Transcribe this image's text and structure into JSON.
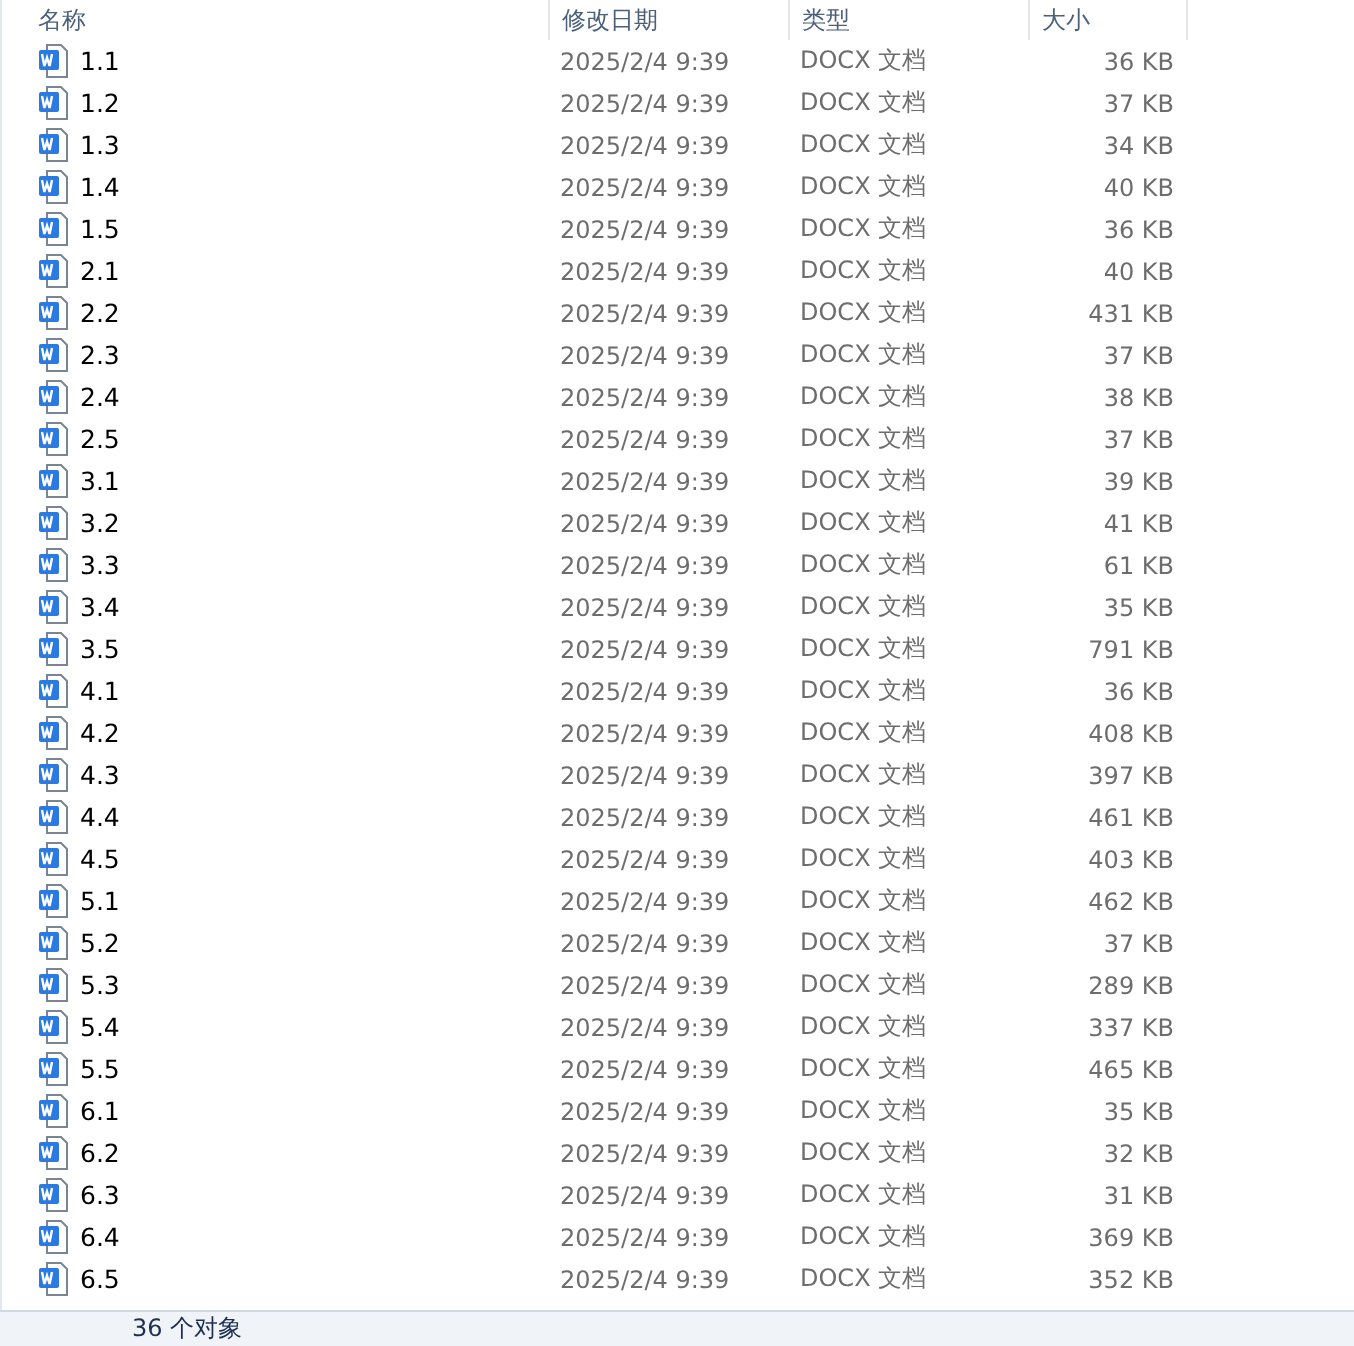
{
  "columns": [
    "名称",
    "修改日期",
    "类型",
    "大小"
  ],
  "rows": [
    {
      "name": "1.1",
      "modified": "2025/2/4 9:39",
      "type": "DOCX 文档",
      "size": "36 KB"
    },
    {
      "name": "1.2",
      "modified": "2025/2/4 9:39",
      "type": "DOCX 文档",
      "size": "37 KB"
    },
    {
      "name": "1.3",
      "modified": "2025/2/4 9:39",
      "type": "DOCX 文档",
      "size": "34 KB"
    },
    {
      "name": "1.4",
      "modified": "2025/2/4 9:39",
      "type": "DOCX 文档",
      "size": "40 KB"
    },
    {
      "name": "1.5",
      "modified": "2025/2/4 9:39",
      "type": "DOCX 文档",
      "size": "36 KB"
    },
    {
      "name": "2.1",
      "modified": "2025/2/4 9:39",
      "type": "DOCX 文档",
      "size": "40 KB"
    },
    {
      "name": "2.2",
      "modified": "2025/2/4 9:39",
      "type": "DOCX 文档",
      "size": "431 KB"
    },
    {
      "name": "2.3",
      "modified": "2025/2/4 9:39",
      "type": "DOCX 文档",
      "size": "37 KB"
    },
    {
      "name": "2.4",
      "modified": "2025/2/4 9:39",
      "type": "DOCX 文档",
      "size": "38 KB"
    },
    {
      "name": "2.5",
      "modified": "2025/2/4 9:39",
      "type": "DOCX 文档",
      "size": "37 KB"
    },
    {
      "name": "3.1",
      "modified": "2025/2/4 9:39",
      "type": "DOCX 文档",
      "size": "39 KB"
    },
    {
      "name": "3.2",
      "modified": "2025/2/4 9:39",
      "type": "DOCX 文档",
      "size": "41 KB"
    },
    {
      "name": "3.3",
      "modified": "2025/2/4 9:39",
      "type": "DOCX 文档",
      "size": "61 KB"
    },
    {
      "name": "3.4",
      "modified": "2025/2/4 9:39",
      "type": "DOCX 文档",
      "size": "35 KB"
    },
    {
      "name": "3.5",
      "modified": "2025/2/4 9:39",
      "type": "DOCX 文档",
      "size": "791 KB"
    },
    {
      "name": "4.1",
      "modified": "2025/2/4 9:39",
      "type": "DOCX 文档",
      "size": "36 KB"
    },
    {
      "name": "4.2",
      "modified": "2025/2/4 9:39",
      "type": "DOCX 文档",
      "size": "408 KB"
    },
    {
      "name": "4.3",
      "modified": "2025/2/4 9:39",
      "type": "DOCX 文档",
      "size": "397 KB"
    },
    {
      "name": "4.4",
      "modified": "2025/2/4 9:39",
      "type": "DOCX 文档",
      "size": "461 KB"
    },
    {
      "name": "4.5",
      "modified": "2025/2/4 9:39",
      "type": "DOCX 文档",
      "size": "403 KB"
    },
    {
      "name": "5.1",
      "modified": "2025/2/4 9:39",
      "type": "DOCX 文档",
      "size": "462 KB"
    },
    {
      "name": "5.2",
      "modified": "2025/2/4 9:39",
      "type": "DOCX 文档",
      "size": "37 KB"
    },
    {
      "name": "5.3",
      "modified": "2025/2/4 9:39",
      "type": "DOCX 文档",
      "size": "289 KB"
    },
    {
      "name": "5.4",
      "modified": "2025/2/4 9:39",
      "type": "DOCX 文档",
      "size": "337 KB"
    },
    {
      "name": "5.5",
      "modified": "2025/2/4 9:39",
      "type": "DOCX 文档",
      "size": "465 KB"
    },
    {
      "name": "6.1",
      "modified": "2025/2/4 9:39",
      "type": "DOCX 文档",
      "size": "35 KB"
    },
    {
      "name": "6.2",
      "modified": "2025/2/4 9:39",
      "type": "DOCX 文档",
      "size": "32 KB"
    },
    {
      "name": "6.3",
      "modified": "2025/2/4 9:39",
      "type": "DOCX 文档",
      "size": "31 KB"
    },
    {
      "name": "6.4",
      "modified": "2025/2/4 9:39",
      "type": "DOCX 文档",
      "size": "369 KB"
    },
    {
      "name": "6.5",
      "modified": "2025/2/4 9:39",
      "type": "DOCX 文档",
      "size": "352 KB"
    }
  ],
  "status_bar": "36 个对象"
}
